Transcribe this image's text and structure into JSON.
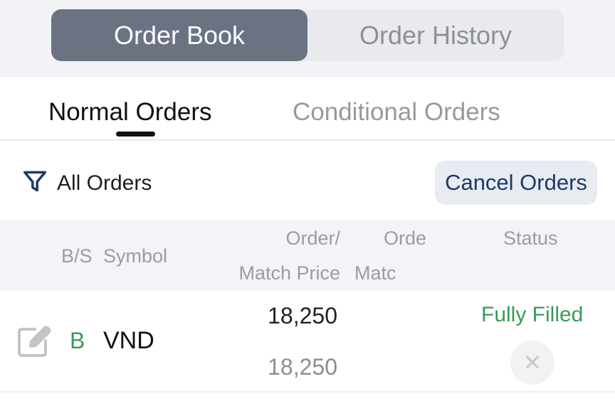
{
  "top_tabs": {
    "active": "Order Book",
    "inactive": "Order History"
  },
  "sub_tabs": {
    "active": "Normal Orders",
    "inactive": "Conditional Orders"
  },
  "filter": {
    "icon": "filter-icon",
    "label": "All Orders"
  },
  "cancel_orders_label": "Cancel Orders",
  "table": {
    "headers": {
      "bs": "B/S",
      "symbol": "Symbol",
      "order_price_line1": "Order/",
      "order_price_line2": "Match Price",
      "order_qty_line1": "Orde",
      "order_qty_line2": "Matc",
      "status": "Status"
    },
    "rows": [
      {
        "side": "B",
        "symbol": "VND",
        "order_price": "18,250",
        "match_price": "18,250",
        "status": "Fully Filled"
      }
    ]
  },
  "colors": {
    "active_tab_bg": "#6b7383",
    "buy_green": "#3a9a58",
    "cancel_text": "#1e3a67"
  }
}
